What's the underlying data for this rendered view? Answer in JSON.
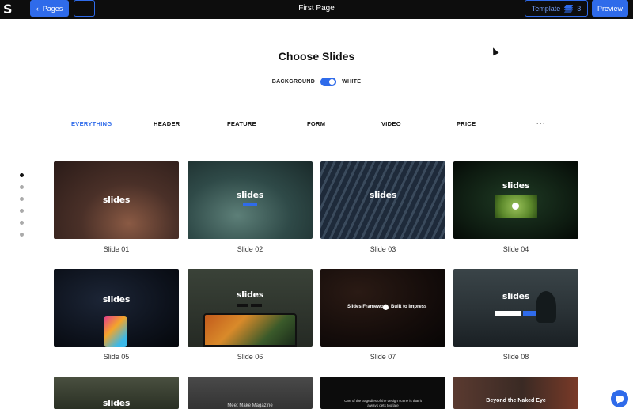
{
  "topbar": {
    "logo": "S",
    "pages_label": "Pages",
    "more_label": "···",
    "page_title": "First Page",
    "template_label": "Template",
    "template_count": "3",
    "preview_label": "Preview"
  },
  "main": {
    "heading": "Choose Slides",
    "toggle": {
      "left_label": "BACKGROUND",
      "right_label": "WHITE",
      "on": true
    },
    "filters": [
      {
        "label": "EVERYTHING",
        "active": true
      },
      {
        "label": "HEADER",
        "active": false
      },
      {
        "label": "FEATURE",
        "active": false
      },
      {
        "label": "FORM",
        "active": false
      },
      {
        "label": "VIDEO",
        "active": false
      },
      {
        "label": "PRICE",
        "active": false
      }
    ],
    "filter_more": "···",
    "slides": [
      {
        "caption": "Slide 01",
        "logo": "slides"
      },
      {
        "caption": "Slide 02",
        "logo": "slides"
      },
      {
        "caption": "Slide 03",
        "logo": "slides"
      },
      {
        "caption": "Slide 04",
        "logo": "slides"
      },
      {
        "caption": "Slide 05",
        "logo": "slides"
      },
      {
        "caption": "Slide 06",
        "logo": "slides"
      },
      {
        "caption": "Slide 07",
        "text_left": "Slides Framework",
        "text_right": "Built to impress"
      },
      {
        "caption": "Slide 08",
        "logo": "slides"
      },
      {
        "logo": "slides"
      },
      {
        "text": "Meet Make Magazine"
      },
      {
        "text": "One of the tragedies of the design scene is that it always gets too late"
      },
      {
        "text": "Beyond the Naked Eye"
      }
    ]
  },
  "colors": {
    "accent": "#2f6bea",
    "topbar": "#0d0d0d"
  }
}
